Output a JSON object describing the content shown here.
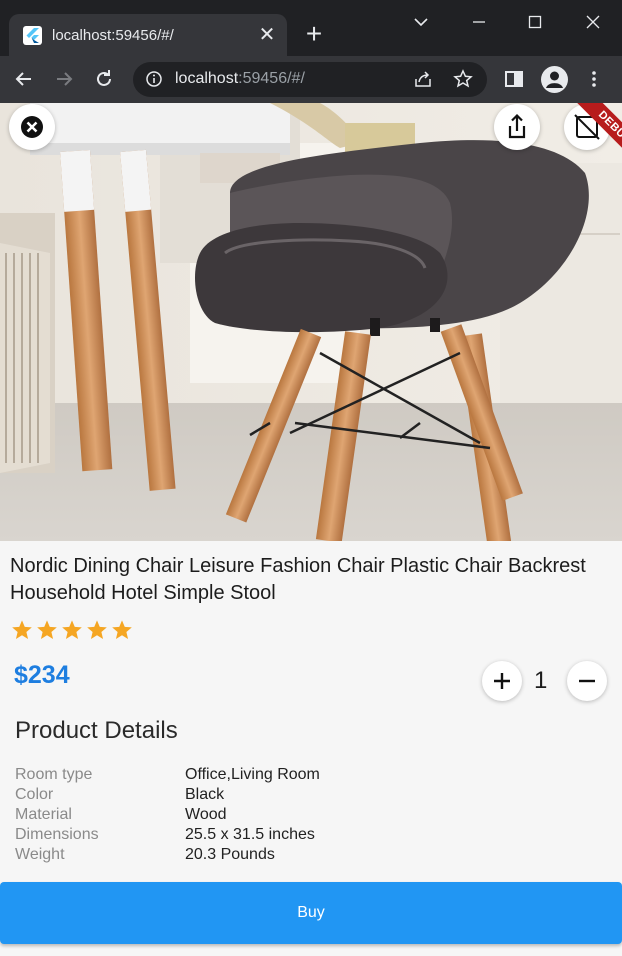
{
  "browser": {
    "tab_title": "localhost:59456/#/",
    "url_host": "localhost",
    "url_rest": ":59456/#/"
  },
  "app": {
    "debug_label": "DEBUG",
    "title": "Nordic Dining Chair Leisure Fashion Chair Plastic Chair Backrest Household Hotel Simple Stool",
    "rating": 5,
    "price": "$234",
    "quantity": "1",
    "details_heading": "Product Details",
    "details": [
      {
        "label": "Room type",
        "value": "Office,Living Room"
      },
      {
        "label": "Color",
        "value": "Black"
      },
      {
        "label": "Material",
        "value": "Wood"
      },
      {
        "label": "Dimensions",
        "value": "25.5 x 31.5 inches"
      },
      {
        "label": "Weight",
        "value": "20.3 Pounds"
      }
    ],
    "buy_label": "Buy",
    "colors": {
      "accent": "#2196f3",
      "price": "#1e7ee0",
      "star": "#f5a623"
    }
  }
}
